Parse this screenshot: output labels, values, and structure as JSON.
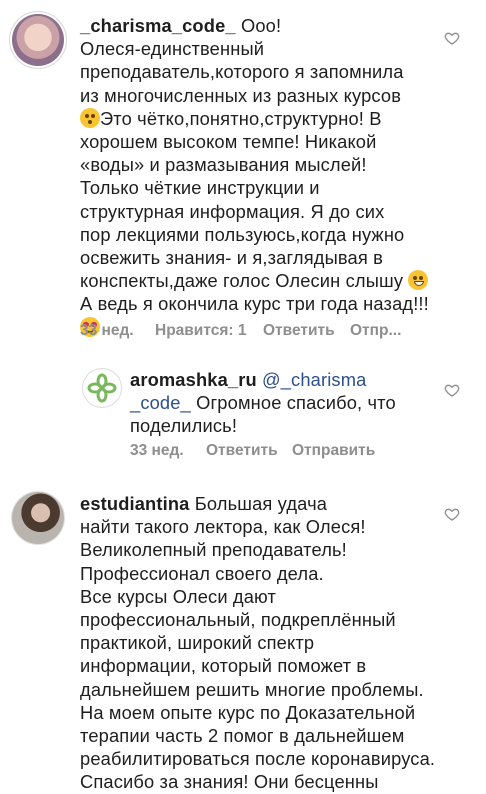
{
  "comments": [
    {
      "username": "_charisma_code_",
      "lines": [
        "Ооо!",
        "Олеся-единственный",
        "преподаватель,которого я запомнила",
        "из многочисленных из разных курсов",
        "Это чётко,понятно,структурно! В",
        "хорошем высоком темпе! Никакой",
        "«воды» и размазывания мыслей!",
        "Только чёткие инструкции и",
        "структурная информация. Я до сих",
        "пор лекциями пользуюсь,когда нужно",
        "освежить знания- и я,заглядывая в",
        "конспекты,даже голос Олесин слышу",
        "А ведь я окончила курс три года назад!!!"
      ],
      "time": "33 нед.",
      "likes": "Нравится: 1",
      "reply": "Ответить",
      "send": "Отпр..."
    }
  ],
  "reply": {
    "username": "aromashka_ru",
    "mention_line1": "@_charisma",
    "mention_line2": "_code_",
    "line2_rest": " Огромное спасибо, что",
    "line3": "поделились!",
    "time": "33 нед.",
    "reply": "Ответить",
    "send": "Отправить"
  },
  "comment2": {
    "username": "estudiantina",
    "lines": [
      "Большая  удача",
      "найти такого лектора, как Олеся!",
      "Великолепный преподаватель!",
      "Профессионал своего дела.",
      "Все курсы Олеси дают",
      "профессиональный, подкреплённый",
      "практикой,  широкий спектр",
      "информации, который поможет в",
      "дальнейшем решить многие проблемы.",
      "На моем опыте курс по Доказательной",
      "терапии часть 2 помог в дальнейшем",
      "реабилитироваться после коронавируса.",
      "Спасибо  за знания! Они бесценны"
    ]
  },
  "colors": {
    "text": "#1e1e1e",
    "meta": "#8e8e8e",
    "mention": "#2c4f8f",
    "logo_green": "#7ab85e"
  }
}
